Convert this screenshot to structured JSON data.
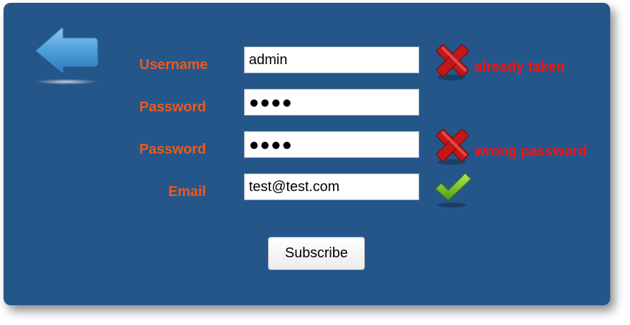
{
  "form": {
    "back_icon": "left-arrow-icon",
    "rows": [
      {
        "label": "Username",
        "value": "admin",
        "status": "error",
        "message": "already taken"
      },
      {
        "label": "Password",
        "value": "●●●●",
        "status": "none",
        "message": ""
      },
      {
        "label": "Password",
        "value": "●●●●",
        "status": "error",
        "message": "wrong password"
      },
      {
        "label": "Email",
        "value": "test@test.com",
        "status": "ok",
        "message": ""
      }
    ],
    "submit_label": "Subscribe"
  },
  "colors": {
    "panel_bg": "#24568a",
    "label": "#ee5a18",
    "error_text": "#ff1010",
    "error_icon": "#c01818",
    "ok_icon": "#66b81e",
    "arrow": "#4f9fd8"
  },
  "icons": {
    "error": "red-x-icon",
    "ok": "green-check-icon"
  }
}
